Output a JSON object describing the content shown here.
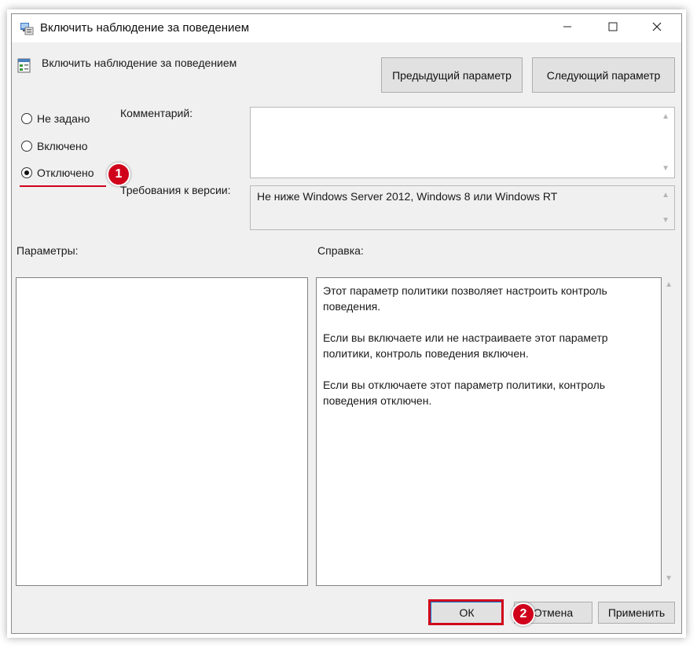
{
  "window": {
    "title": "Включить наблюдение за поведением"
  },
  "policy": {
    "name": "Включить наблюдение за поведением"
  },
  "nav": {
    "prev_label": "Предыдущий параметр",
    "next_label": "Следующий параметр"
  },
  "options": [
    {
      "label": "Не задано",
      "checked": false
    },
    {
      "label": "Включено",
      "checked": false
    },
    {
      "label": "Отключено",
      "checked": true
    }
  ],
  "comment": {
    "label": "Комментарий:",
    "value": ""
  },
  "version": {
    "label": "Требования к версии:",
    "value": "Не ниже Windows Server 2012, Windows 8 или Windows RT"
  },
  "params": {
    "label": "Параметры:"
  },
  "help": {
    "label": "Справка:",
    "paragraphs": [
      "Этот параметр политики позволяет настроить контроль поведения.",
      "Если вы включаете или не настраиваете этот параметр политики, контроль поведения включен.",
      "Если вы отключаете этот параметр политики, контроль поведения отключен."
    ]
  },
  "footer": {
    "ok_label": "ОК",
    "cancel_label": "Отмена",
    "apply_label": "Применить"
  },
  "annotations": {
    "step1": "1",
    "step2": "2",
    "highlight_color": "#d0021b"
  },
  "icons": {
    "app": "group-policy-icon",
    "policy": "policy-setting-icon",
    "minimize": "minimize-icon",
    "maximize": "maximize-icon",
    "close": "close-icon"
  }
}
